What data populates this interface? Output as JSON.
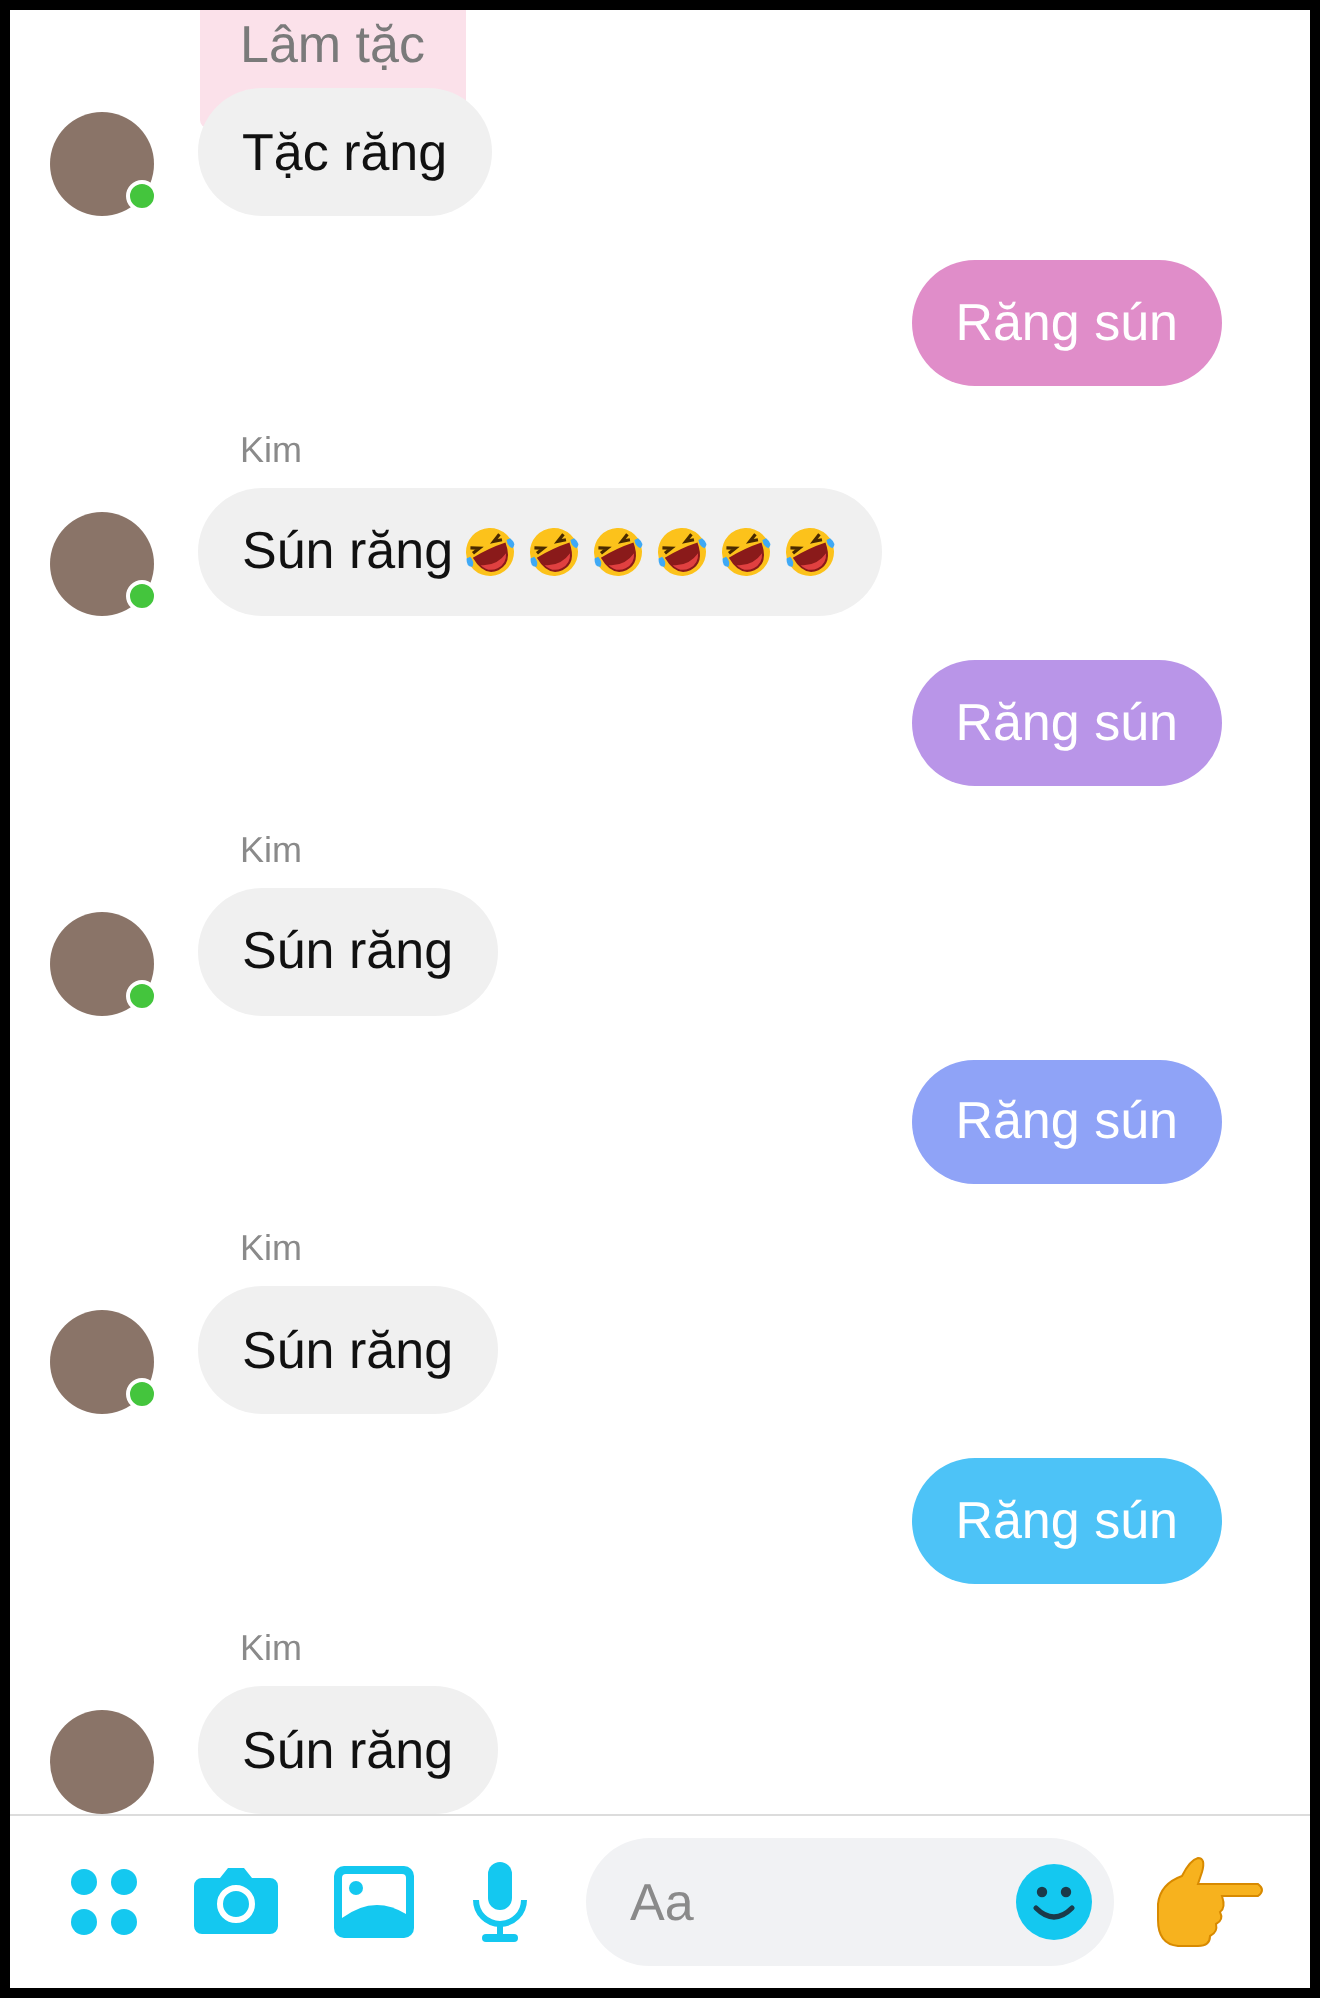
{
  "messages": [
    {
      "kind": "quote",
      "text": "Lâm tặc"
    },
    {
      "kind": "incoming",
      "text": "Tặc răng",
      "online": true
    },
    {
      "kind": "outgoing",
      "text": "Răng sún",
      "color": "#e08dc9"
    },
    {
      "kind": "incoming",
      "sender": "Kim",
      "text": "Sún răng",
      "online": true,
      "emojis": [
        {
          "kind": "rofl"
        },
        {
          "kind": "rofl"
        },
        {
          "kind": "rofl"
        },
        {
          "kind": "rofl"
        },
        {
          "kind": "rofl"
        },
        {
          "kind": "rofl"
        }
      ]
    },
    {
      "kind": "outgoing",
      "text": "Răng sún",
      "color": "#b995e8"
    },
    {
      "kind": "incoming",
      "sender": "Kim",
      "text": "Sún răng",
      "online": true
    },
    {
      "kind": "outgoing",
      "text": "Răng sún",
      "color": "#8fa3f7"
    },
    {
      "kind": "incoming",
      "sender": "Kim",
      "text": "Sún răng",
      "online": true
    },
    {
      "kind": "outgoing",
      "text": "Răng sún",
      "color": "#4dc3f7"
    },
    {
      "kind": "incoming",
      "sender": "Kim",
      "text": "Sún răng",
      "online": false
    }
  ],
  "composer": {
    "placeholder": "Aa"
  }
}
